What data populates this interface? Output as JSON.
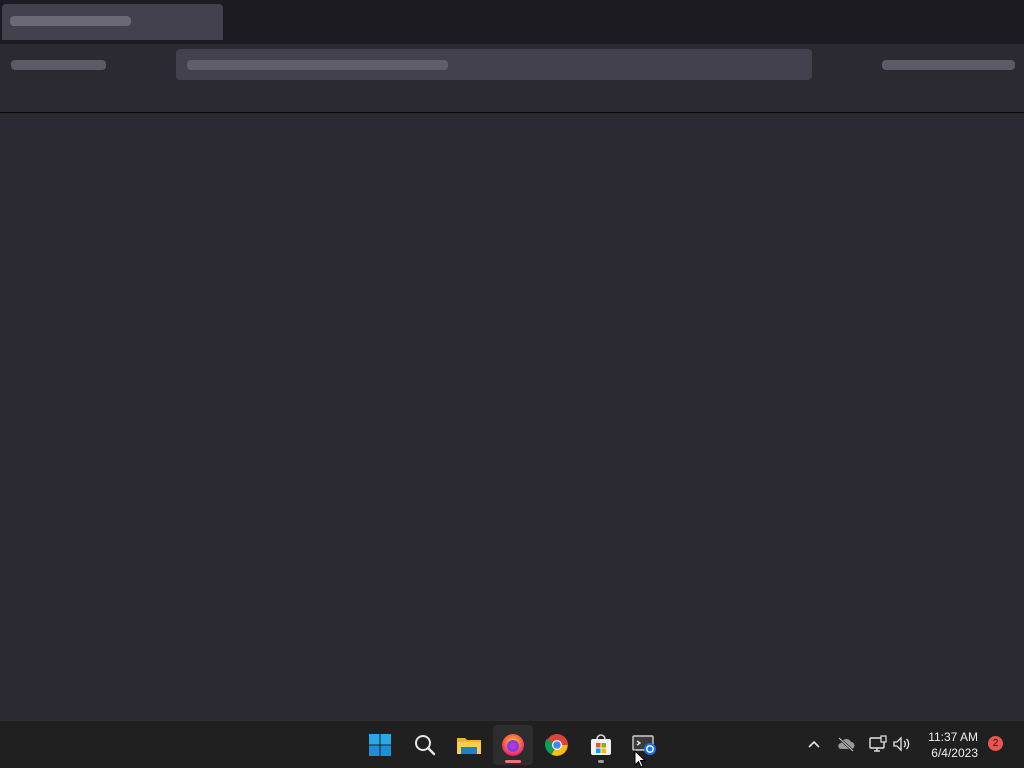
{
  "taskbar": {
    "apps": [
      {
        "name": "start",
        "icon": "windows-logo-icon"
      },
      {
        "name": "search",
        "icon": "search-icon"
      },
      {
        "name": "file-explorer",
        "icon": "folder-icon"
      },
      {
        "name": "firefox",
        "icon": "firefox-icon",
        "active": true
      },
      {
        "name": "chrome",
        "icon": "chrome-icon"
      },
      {
        "name": "microsoft-store",
        "icon": "store-icon"
      },
      {
        "name": "remote-desktop",
        "icon": "remote-desktop-icon"
      }
    ],
    "tray": {
      "clock_time": "11:37 AM",
      "clock_date": "6/4/2023",
      "notification_count": "2"
    }
  },
  "colors": {
    "page_bg": "#2b2a33",
    "tabbar_bg": "#1c1b22",
    "taskbar_bg": "#202020",
    "firefox_indicator": "#f1707b",
    "badge": "#e8574f"
  }
}
